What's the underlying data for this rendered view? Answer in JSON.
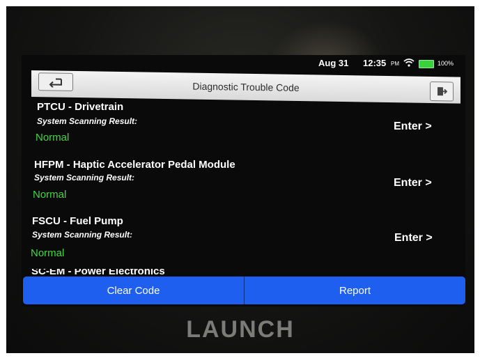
{
  "status_bar": {
    "date": "Aug 31",
    "time": "12:35",
    "ampm": "PM",
    "battery": "100%",
    "battery_color": "#38d23a"
  },
  "header": {
    "title": "Diagnostic Trouble Code",
    "back_icon": "back-arrow-icon",
    "exit_icon": "exit-door-icon"
  },
  "items": [
    {
      "name": "PTCU - Drivetrain",
      "subtitle": "System Scanning Result:",
      "status": "Normal",
      "action": "Enter >"
    },
    {
      "name": "HFPM - Haptic Accelerator Pedal Module",
      "subtitle": "System Scanning Result:",
      "status": "Normal",
      "action": "Enter >"
    },
    {
      "name": "FSCU - Fuel Pump",
      "subtitle": "System Scanning Result:",
      "status": "Normal",
      "action": "Enter >"
    }
  ],
  "partial_item": "SC-EM - Power Electronics",
  "footer": {
    "clear_code": "Clear Code",
    "report": "Report",
    "button_color": "#1f5ff0"
  },
  "device_brand": "LAUNCH",
  "status_color_normal": "#3fd93f"
}
